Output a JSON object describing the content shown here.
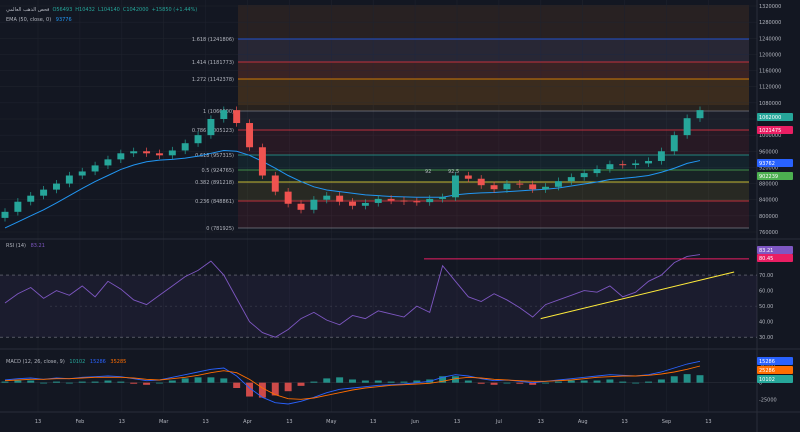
{
  "header": {
    "line1_parts": [
      {
        "text": "فحص الذهب العالمي",
        "color": "#b2b5be"
      },
      {
        "text": "O56493",
        "color": "#26a69a"
      },
      {
        "text": "H10432",
        "color": "#26a69a"
      },
      {
        "text": "L104140",
        "color": "#26a69a"
      },
      {
        "text": "C1042000",
        "color": "#26a69a"
      },
      {
        "text": "+15850 (+1.44%)",
        "color": "#26a69a"
      }
    ],
    "ema_label": "EMA (50, close, 0)",
    "ema_value": "93776",
    "rsi_label": "RSI (14)",
    "rsi_value": "83.21",
    "macd_label": "MACD (12, 26, close, 9)",
    "macd_values": [
      "10102",
      "15286",
      "35285"
    ]
  },
  "fib_levels": [
    {
      "label": "1.618 (1241806)",
      "color": "#2962ff"
    },
    {
      "label": "1.414 (1181773)",
      "color": "#f23645"
    },
    {
      "label": "1.272 (1142378)",
      "color": "#ff9800"
    },
    {
      "label": "1 (1066800)",
      "color": "#787b86"
    },
    {
      "label": "0.786 (1005123)",
      "color": "#f23645"
    },
    {
      "label": "0.618 (957315)",
      "color": "#26a69a"
    },
    {
      "label": "0.5 (924765)",
      "color": "#4caf50"
    },
    {
      "label": "0.382 (891218)",
      "color": "#ffeb3b"
    },
    {
      "label": "0.236 (848861)",
      "color": "#f23645"
    },
    {
      "label": "0 (781925)",
      "color": "#787b86"
    }
  ],
  "annotations": [
    "92",
    "92.5"
  ],
  "price_badges": [
    {
      "text": "1062000",
      "color": "#26a69a"
    },
    {
      "text": "1021475",
      "color": "#e91e63"
    },
    {
      "text": "93762",
      "color": "#2962ff"
    },
    {
      "text": "902239",
      "color": "#4caf50"
    }
  ],
  "rsi_badges": [
    {
      "text": "83.21",
      "color": "#7e57c2"
    },
    {
      "text": "80.45",
      "color": "#e91e63"
    }
  ],
  "macd_badges": [
    {
      "text": "15286",
      "color": "#2962ff"
    },
    {
      "text": "25286",
      "color": "#ff6d00"
    },
    {
      "text": "10102",
      "color": "#26a69a"
    }
  ],
  "colors": {
    "up": "#26a69a",
    "down": "#ef5350",
    "ema": "#2196f3",
    "rsi": "#7e57c2",
    "macd": "#2962ff",
    "signal": "#ff6d00",
    "trend": "#ffeb3b",
    "rsi_level": "#e91e63"
  },
  "chart_data": {
    "type": "candlestick",
    "x_ticks": [
      "13",
      "Feb",
      "13",
      "Mar",
      "13",
      "Apr",
      "13",
      "May",
      "13",
      "Jun",
      "13",
      "Jul",
      "13",
      "Aug",
      "13",
      "Sep",
      "13"
    ],
    "price_axis": [
      "1320000",
      "1280000",
      "1240000",
      "1200000",
      "1160000",
      "1120000",
      "1080000",
      "1040000",
      "1000000",
      "960000",
      "920000",
      "880000",
      "840000",
      "800000",
      "760000"
    ],
    "price_range": [
      760000,
      1320000
    ],
    "close_series": [
      810000,
      835000,
      850000,
      865000,
      880000,
      900000,
      910000,
      925000,
      940000,
      955000,
      960000,
      955000,
      950000,
      962000,
      980000,
      1000000,
      1040000,
      1062000,
      1030000,
      970000,
      900000,
      860000,
      830000,
      815000,
      840000,
      850000,
      835000,
      825000,
      832000,
      842000,
      838000,
      836000,
      834000,
      842000,
      846000,
      900000,
      892000,
      876000,
      866000,
      880000,
      878000,
      866000,
      872000,
      886000,
      896000,
      906000,
      916000,
      928000,
      926000,
      930000,
      936000,
      960000,
      1000000,
      1042000,
      1062000
    ],
    "ema_series": [
      770000,
      785000,
      800000,
      815000,
      832000,
      850000,
      868000,
      885000,
      900000,
      915000,
      926000,
      934000,
      938000,
      940000,
      943000,
      948000,
      955000,
      962000,
      960000,
      950000,
      935000,
      918000,
      900000,
      885000,
      872000,
      864000,
      860000,
      856000,
      852000,
      850000,
      848000,
      847000,
      846000,
      846000,
      846000,
      852000,
      855000,
      857000,
      858000,
      860000,
      862000,
      864000,
      866000,
      869000,
      874000,
      879000,
      884000,
      890000,
      893000,
      896000,
      900000,
      908000,
      918000,
      930000,
      937000
    ],
    "rsi_axis": [
      "80.00",
      "70.00",
      "60.00",
      "50.00",
      "40.00",
      "30.00"
    ],
    "rsi_range": [
      25,
      90
    ],
    "rsi_levels": [
      70,
      30
    ],
    "rsi_series": [
      52,
      58,
      62,
      55,
      60,
      57,
      63,
      56,
      66,
      61,
      54,
      51,
      57,
      63,
      69,
      73,
      79,
      70,
      55,
      40,
      33,
      30,
      35,
      42,
      46,
      41,
      38,
      44,
      42,
      47,
      45,
      43,
      50,
      46,
      76,
      66,
      56,
      53,
      58,
      54,
      49,
      43,
      51,
      54,
      57,
      60,
      59,
      63,
      56,
      59,
      66,
      70,
      78,
      82,
      83.2
    ],
    "rsi_trend": {
      "from": [
        0.72,
        42
      ],
      "to": [
        0.98,
        72
      ]
    },
    "macd_axis": [
      "25000",
      "0",
      "-25000"
    ],
    "macd_range": [
      -38000,
      40000
    ],
    "macd_series": [
      4000,
      6000,
      7000,
      5000,
      7000,
      6000,
      8000,
      9000,
      10000,
      9000,
      6000,
      3000,
      4000,
      8000,
      12000,
      16000,
      20000,
      22000,
      10000,
      -8000,
      -22000,
      -30000,
      -32000,
      -28000,
      -22000,
      -15000,
      -10000,
      -8000,
      -6000,
      -4000,
      -3000,
      -2000,
      0,
      2000,
      8000,
      12000,
      10000,
      6000,
      3000,
      4000,
      2000,
      0,
      2000,
      4000,
      6000,
      8000,
      10000,
      12000,
      11000,
      10000,
      12000,
      16000,
      22000,
      28000,
      32000
    ],
    "signal_series": [
      3000,
      4000,
      5000,
      5000,
      6000,
      6000,
      7000,
      8000,
      8000,
      8000,
      7000,
      5000,
      4000,
      6000,
      8000,
      11000,
      15000,
      18000,
      15000,
      5000,
      -8000,
      -18000,
      -24000,
      -25000,
      -23000,
      -19000,
      -15000,
      -11000,
      -8000,
      -6000,
      -4000,
      -3000,
      -2000,
      -1000,
      2000,
      6000,
      8000,
      7000,
      5000,
      4000,
      3000,
      2000,
      2000,
      3000,
      4000,
      6000,
      8000,
      9000,
      10000,
      10000,
      11000,
      13000,
      16000,
      20000,
      25000
    ]
  }
}
